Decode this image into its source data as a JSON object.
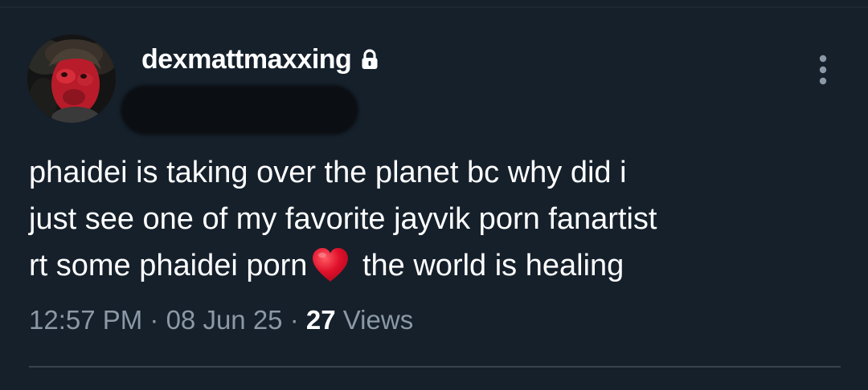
{
  "tweet": {
    "username": "dexmattmaxxing",
    "protected_icon": "lock-icon",
    "more_icon": "more-vertical-icon",
    "text_part1": "phaidei is taking over the planet bc why did i\njust see one of my favorite jayvik porn fanartist\nrt some phaidei porn",
    "emoji_icon": "red-heart-icon",
    "text_part2": " the world is healing",
    "time": "12:57 PM",
    "separator": " · ",
    "date": "08 Jun 25",
    "views_count": "27",
    "views_label": " Views"
  },
  "colors": {
    "background": "#15202b",
    "text_primary": "#ffffff",
    "text_secondary": "#8b98a5",
    "divider": "#38444d",
    "heart": "#e0112b"
  }
}
